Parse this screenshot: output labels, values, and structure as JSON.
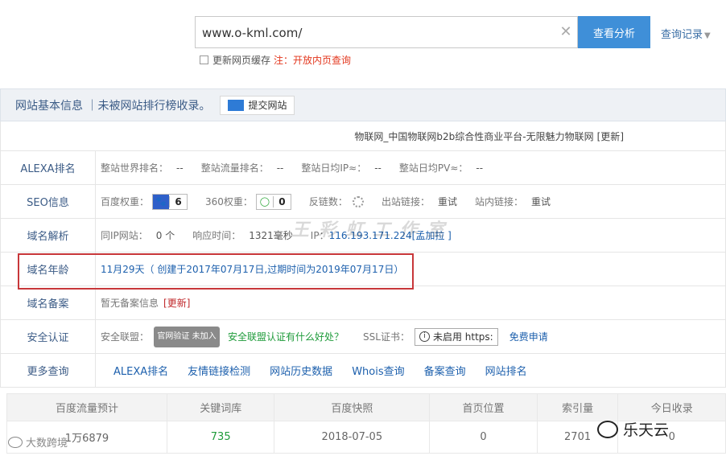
{
  "search": {
    "url_value": "www.o-kml.com/",
    "analyze_label": "查看分析",
    "history_label": "查询记录",
    "cache_label": "更新网页缓存",
    "note_label": "注：",
    "note_text": "开放内页查询"
  },
  "panel": {
    "title": "网站基本信息 ｜未被网站排行榜收录。",
    "submit_label": "提交网站",
    "site_title": "物联网_中国物联网b2b综合性商业平台-无限魅力物联网",
    "refresh_label": "更新"
  },
  "rows": {
    "alexa": {
      "label": "ALEXA排名",
      "world_rank_k": "整站世界排名：",
      "world_rank_v": "--",
      "traffic_rank_k": "整站流量排名：",
      "traffic_rank_v": "--",
      "daily_ip_k": "整站日均IP≈：",
      "daily_ip_v": "--",
      "daily_pv_k": "整站日均PV≈：",
      "daily_pv_v": "--"
    },
    "seo": {
      "label": "SEO信息",
      "baidu_k": "百度权重：",
      "baidu_v": "6",
      "s360_k": "360权重：",
      "s360_v": "0",
      "backlinks_k": "反链数：",
      "outlinks_k": "出站链接：",
      "outlinks_v": "重试",
      "inlinks_k": "站内链接：",
      "inlinks_v": "重试"
    },
    "dns": {
      "label": "域名解析",
      "sameip_k": "同IP网站：",
      "sameip_v": "0 个",
      "resp_k": "响应时间：",
      "resp_v": "1321毫秒",
      "ip_k": "IP：",
      "ip_v": "116.193.171.224",
      "location": "孟加拉 ]"
    },
    "age": {
      "label": "域名年龄",
      "value": "11月29天（ 创建于2017年07月17日,过期时间为2019年07月17日）"
    },
    "icp": {
      "label": "域名备案",
      "value": "暂无备案信息",
      "refresh": "更新"
    },
    "security": {
      "label": "安全认证",
      "alliance_k": "安全联盟：",
      "seal_text": "官网验证 未加入",
      "benefit_link": "安全联盟认证有什么好处？",
      "ssl_k": "SSL证书：",
      "ssl_btn": "未启用 https:",
      "apply_link": "免费申请"
    },
    "more": {
      "label": "更多查询",
      "links": [
        "ALEXA排名",
        "友情链接检测",
        "网站历史数据",
        "Whois查询",
        "备案查询",
        "网站排名"
      ]
    }
  },
  "stats": {
    "headers": [
      "百度流量预计",
      "关键词库",
      "百度快照",
      "首页位置",
      "索引量",
      "今日收录"
    ],
    "values": [
      "1万6879",
      "735",
      "2018-07-05",
      "0",
      "2701",
      "0"
    ]
  },
  "watermarks": {
    "center": "王 彩 虹 工 作 室",
    "brand": "乐天云",
    "brand2": "大数跨境"
  }
}
